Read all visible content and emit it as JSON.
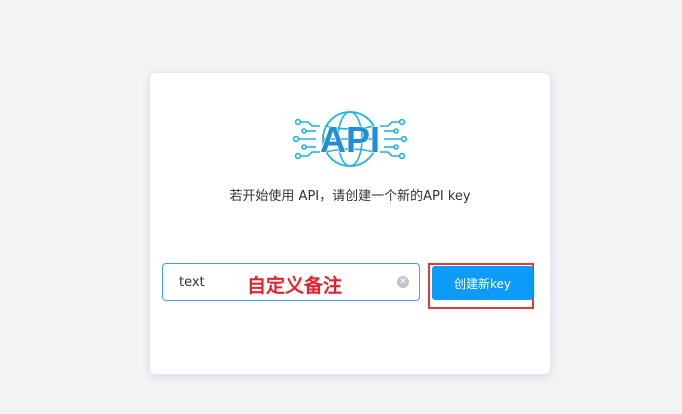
{
  "card": {
    "logo_text": "API",
    "subtitle": "若开始使用 API，请创建一个新的API key"
  },
  "form": {
    "remark_value": "text",
    "annotation": "自定义备注",
    "clear_icon": "circle-close-icon",
    "create_button_label": "创建新key"
  },
  "colors": {
    "accent": "#0e9bf7",
    "logo_blue": "#1f8fd6",
    "logo_line": "#1bb4e6",
    "highlight_red": "#e53935",
    "annotation_red": "#e8222c"
  }
}
